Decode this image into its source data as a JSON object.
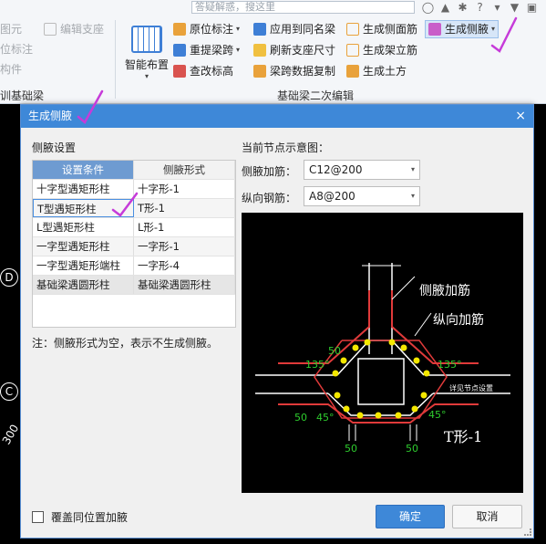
{
  "ribbon": {
    "search_placeholder": "答疑解惑，搜这里",
    "left_items": [
      "图元",
      "位标注",
      "构件"
    ],
    "left_group": "训基础梁",
    "disabled_item": "编辑支座",
    "smart_layout": "智能布置",
    "buttons": {
      "in_situ_label": "原位标注",
      "relay_span": "重提梁跨",
      "check_label": "查改标高",
      "apply_same": "应用到同名梁",
      "refresh_support": "刷新支座尺寸",
      "span_copy": "梁跨数据复制",
      "gen_side_rebar": "生成侧面筋",
      "gen_stirrup": "生成架立筋",
      "gen_earth": "生成土方",
      "gen_haunch": "生成侧腋"
    },
    "group_label": "基础梁二次编辑"
  },
  "canvas": {
    "axis_d": "D",
    "axis_c": "C",
    "dim_text": "300"
  },
  "dialog": {
    "title": "生成侧腋",
    "close": "×",
    "settings_title": "侧腋设置",
    "table": {
      "headers": [
        "设置条件",
        "侧腋形式"
      ],
      "rows": [
        [
          "十字型遇矩形柱",
          "十字形-1"
        ],
        [
          "T型遇矩形柱",
          "T形-1"
        ],
        [
          "L型遇矩形柱",
          "L形-1"
        ],
        [
          "一字型遇矩形柱",
          "一字形-1"
        ],
        [
          "一字型遇矩形端柱",
          "一字形-4"
        ],
        [
          "基础梁遇圆形柱",
          "基础梁遇圆形柱"
        ]
      ]
    },
    "note": "注：侧腋形式为空，表示不生成侧腋。",
    "diagram_title": "当前节点示意图：",
    "haunch_rebar_label": "侧腋加筋：",
    "haunch_rebar_value": "C12@200",
    "long_rebar_label": "纵向钢筋：",
    "long_rebar_value": "A8@200",
    "diagram": {
      "label_haunch": "侧腋加筋",
      "label_long": "纵向加筋",
      "type_label": "T形-1",
      "note_text": "详见节点设置",
      "dim_50": "50",
      "dim_135": "135°",
      "dim_45": "45°"
    },
    "overwrite_label": "覆盖同位置加腋",
    "ok_label": "确定",
    "cancel_label": "取消"
  },
  "colors": {
    "titlebar": "#3e88d8",
    "annotation": "#c63bd9",
    "rebar_red": "#e03a3a",
    "rebar_yellow": "#f5e800",
    "dim_green": "#2ecc2e"
  }
}
